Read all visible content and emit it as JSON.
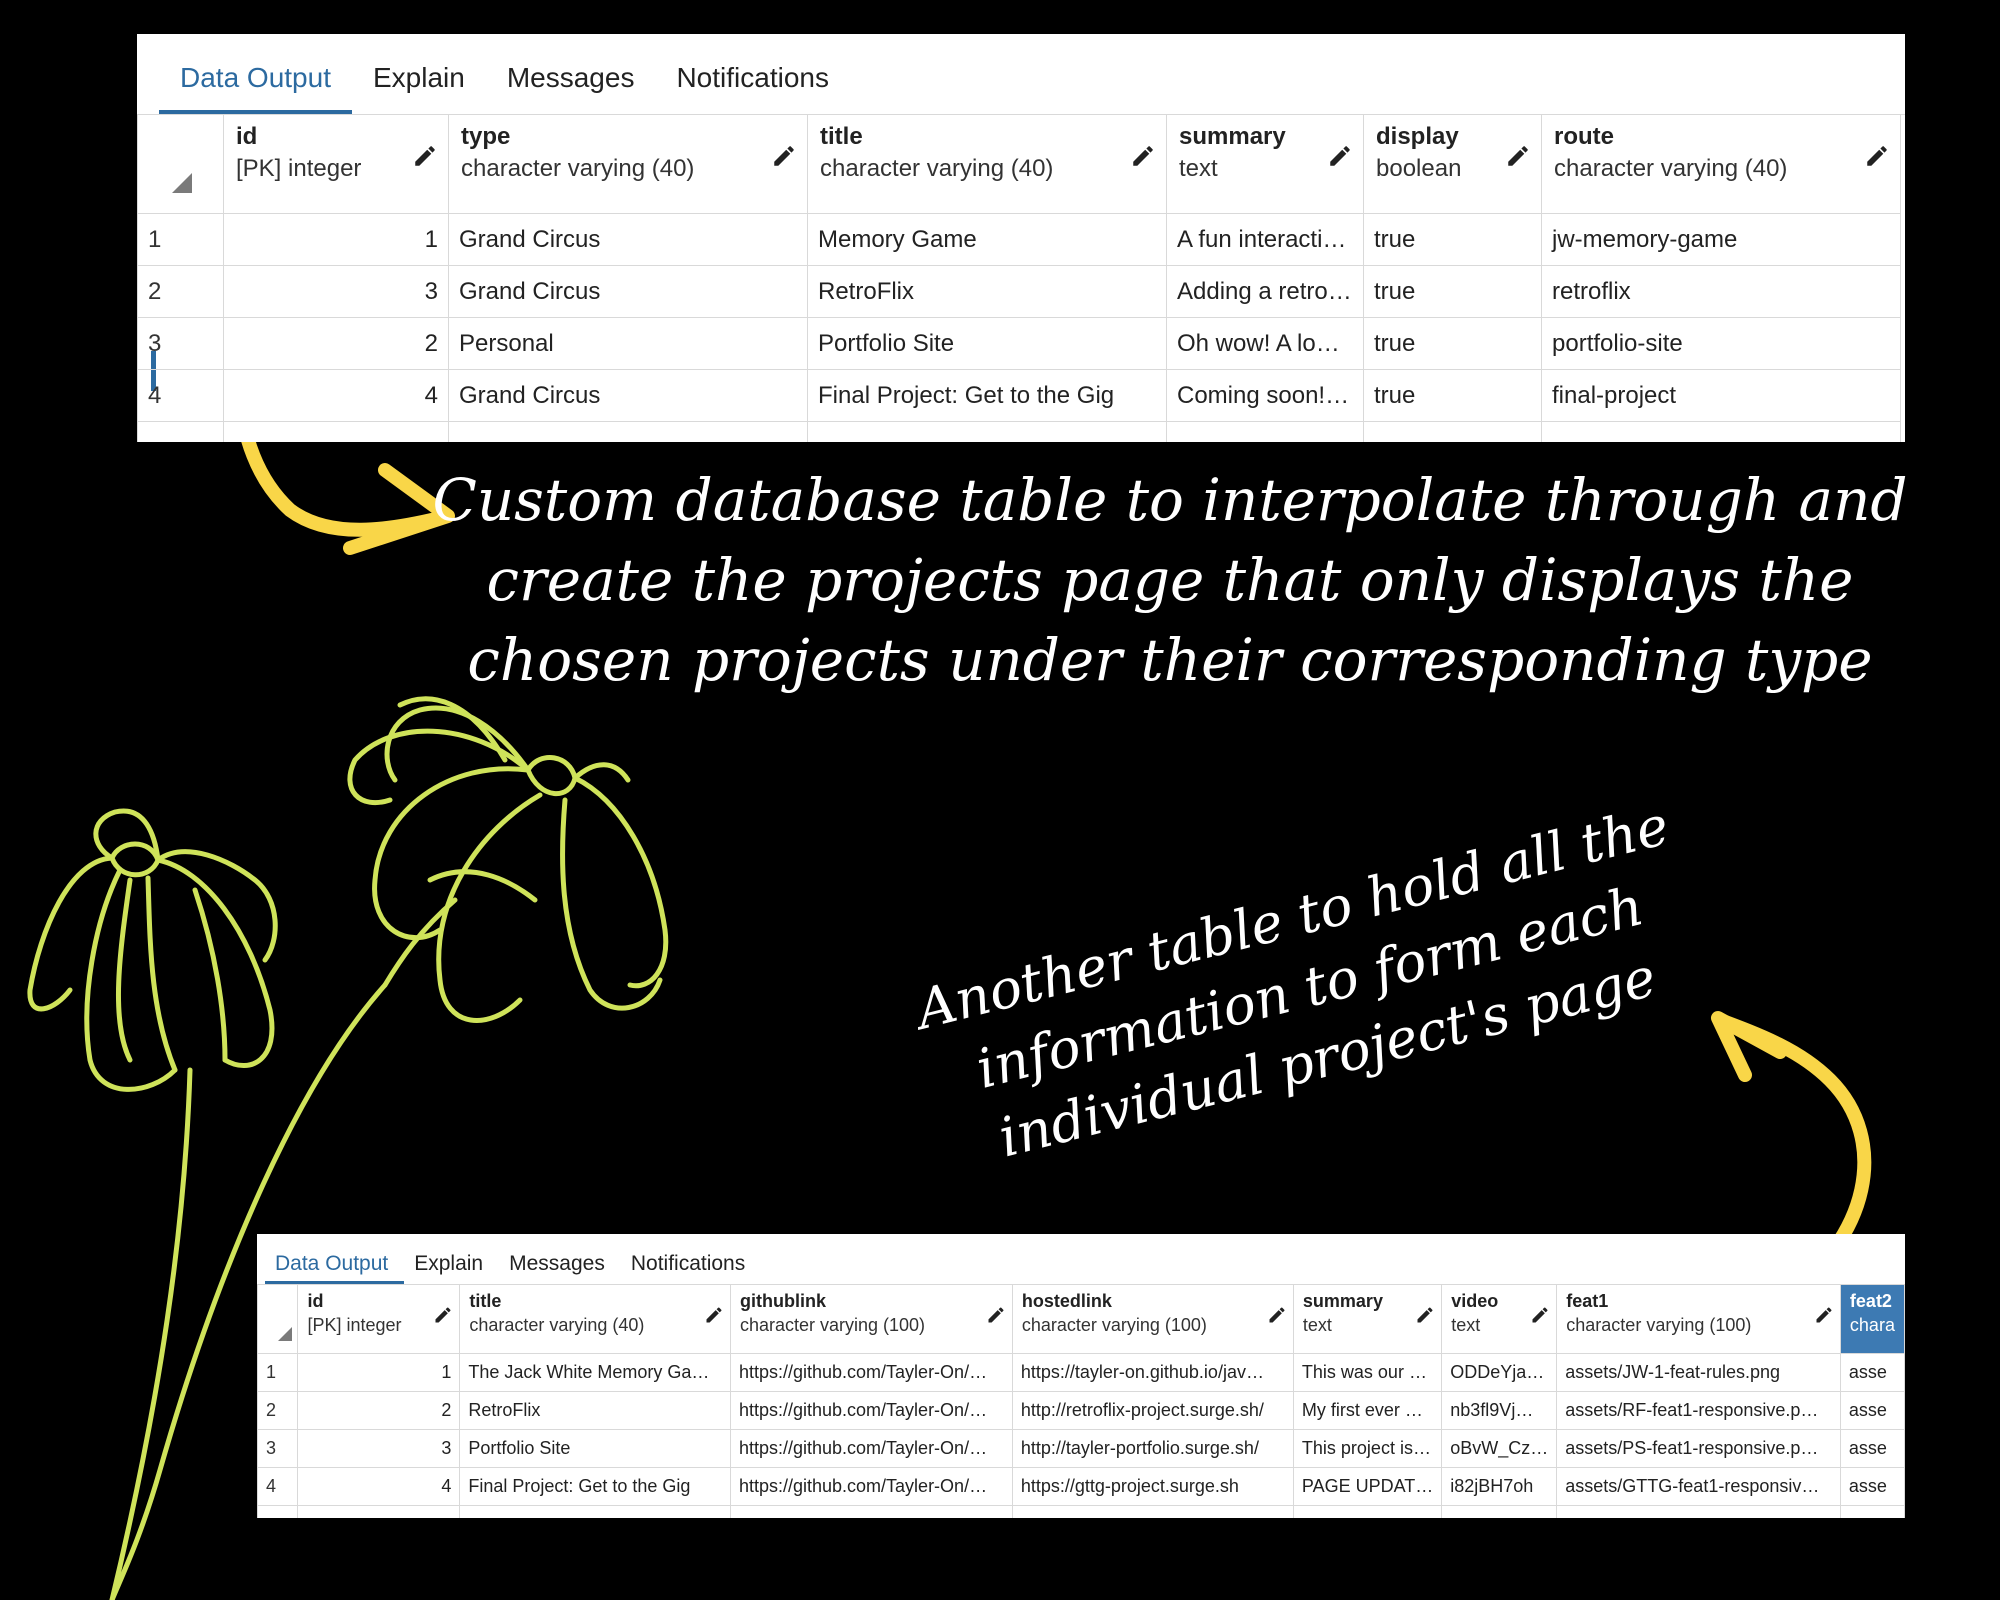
{
  "captions": {
    "top": "Custom database table to interpolate through and create the projects page that only displays the chosen projects under their corresponding type",
    "bottom": "Another table to hold all the information to form each individual project's page"
  },
  "colors": {
    "background": "#000000",
    "arrow": "#f9d648",
    "flower": "#cfe35a",
    "tab_active": "#2c6aa0",
    "highlight_header": "#3d7ab3"
  },
  "icons": {
    "edit": "pencil-icon",
    "select_all": "corner-triangle-icon",
    "decoration": "flower-line-art",
    "pointer": "curved-arrow"
  },
  "projects_panel": {
    "tabs": [
      {
        "label": "Data Output",
        "active": true
      },
      {
        "label": "Explain",
        "active": false
      },
      {
        "label": "Messages",
        "active": false
      },
      {
        "label": "Notifications",
        "active": false
      }
    ],
    "columns": [
      {
        "name": "id",
        "type": "[PK] integer"
      },
      {
        "name": "type",
        "type": "character varying (40)"
      },
      {
        "name": "title",
        "type": "character varying (40)"
      },
      {
        "name": "summary",
        "type": "text"
      },
      {
        "name": "display",
        "type": "boolean"
      },
      {
        "name": "route",
        "type": "character varying (40)"
      }
    ],
    "rows": [
      {
        "n": "1",
        "cells": [
          "1",
          "Grand Circus",
          "Memory Game",
          "A fun interacti…",
          "true",
          "jw-memory-game"
        ]
      },
      {
        "n": "2",
        "cells": [
          "3",
          "Grand Circus",
          "RetroFlix",
          "Adding a retro…",
          "true",
          "retroflix"
        ]
      },
      {
        "n": "3",
        "cells": [
          "2",
          "Personal",
          "Portfolio Site",
          "Oh wow! A lo…",
          "true",
          "portfolio-site"
        ]
      },
      {
        "n": "4",
        "cells": [
          "4",
          "Grand Circus",
          "Final Project: Get to the Gig",
          "Coming soon!…",
          "true",
          "final-project"
        ]
      }
    ]
  },
  "details_panel": {
    "tabs": [
      {
        "label": "Data Output",
        "active": true
      },
      {
        "label": "Explain",
        "active": false
      },
      {
        "label": "Messages",
        "active": false
      },
      {
        "label": "Notifications",
        "active": false
      }
    ],
    "columns": [
      {
        "name": "id",
        "type": "[PK] integer"
      },
      {
        "name": "title",
        "type": "character varying (40)"
      },
      {
        "name": "githublink",
        "type": "character varying (100)"
      },
      {
        "name": "hostedlink",
        "type": "character varying (100)"
      },
      {
        "name": "summary",
        "type": "text"
      },
      {
        "name": "video",
        "type": "text"
      },
      {
        "name": "feat1",
        "type": "character varying (100)"
      },
      {
        "name": "feat2",
        "type": "chara"
      }
    ],
    "rows": [
      {
        "n": "1",
        "cells": [
          "1",
          "The Jack White Memory Ga…",
          "https://github.com/Tayler-On/…",
          "https://tayler-on.github.io/jav…",
          "This was our …",
          "ODDeYja…",
          "assets/JW-1-feat-rules.png",
          "asse"
        ]
      },
      {
        "n": "2",
        "cells": [
          "2",
          "RetroFlix",
          "https://github.com/Tayler-On/…",
          "http://retroflix-project.surge.sh/",
          "My first ever …",
          "nb3fl9Vj…",
          "assets/RF-feat1-responsive.p…",
          "asse"
        ]
      },
      {
        "n": "3",
        "cells": [
          "3",
          "Portfolio Site",
          "https://github.com/Tayler-On/…",
          "http://tayler-portfolio.surge.sh/",
          "This project is…",
          "oBvW_Cz…",
          "assets/PS-feat1-responsive.p…",
          "asse"
        ]
      },
      {
        "n": "4",
        "cells": [
          "4",
          "Final Project: Get to the Gig",
          "https://github.com/Tayler-On/…",
          "https://gttg-project.surge.sh",
          "PAGE UPDAT…",
          "i82jBH7oh",
          "assets/GTTG-feat1-responsiv…",
          "asse"
        ]
      }
    ]
  }
}
